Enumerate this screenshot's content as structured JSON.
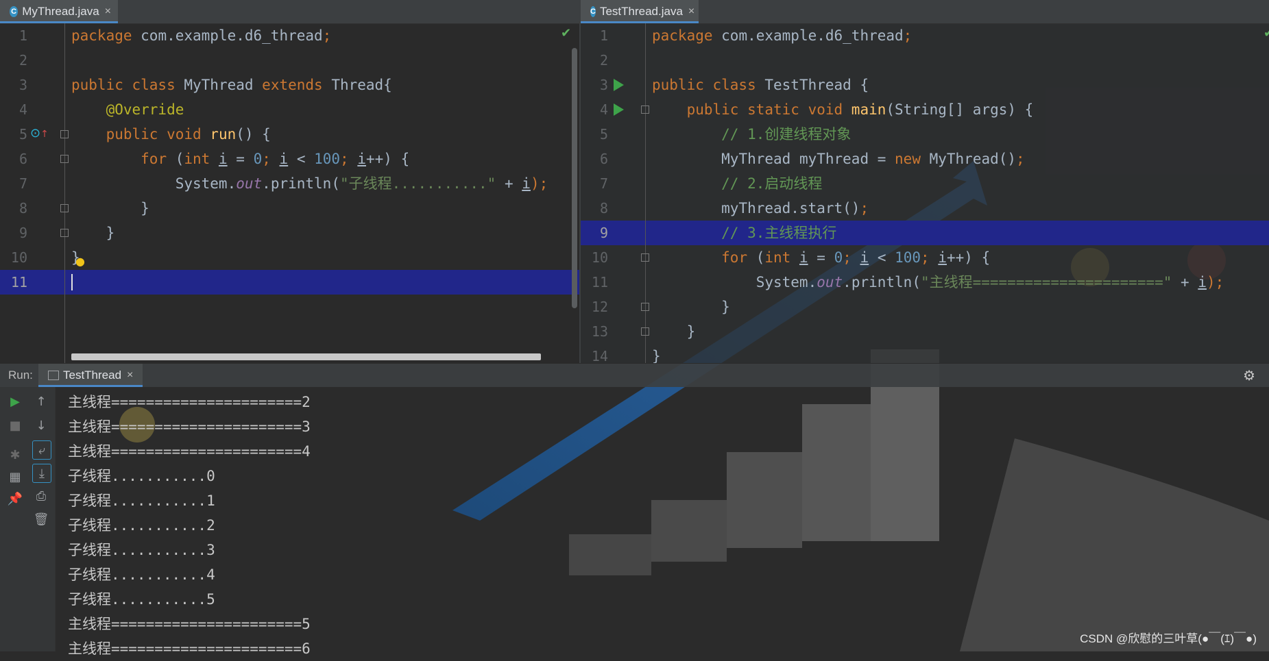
{
  "colors": {
    "accent": "#4a88c7",
    "current_line": "#21268a",
    "run_green": "#3ea34a"
  },
  "left_editor": {
    "tab_label": "MyThread.java",
    "file_icon": "C",
    "line_numbers": [
      "1",
      "2",
      "3",
      "4",
      "5",
      "6",
      "7",
      "8",
      "9",
      "10",
      "11"
    ],
    "lines": [
      {
        "parts": [
          {
            "t": "package ",
            "c": "kw"
          },
          {
            "t": "com.example.d6_thread",
            "c": "cls"
          },
          {
            "t": ";",
            "c": "semi"
          }
        ]
      },
      {
        "parts": []
      },
      {
        "parts": [
          {
            "t": "public class ",
            "c": "kw"
          },
          {
            "t": "MyThread ",
            "c": "cls"
          },
          {
            "t": "extends ",
            "c": "kw"
          },
          {
            "t": "Thread{",
            "c": "cls"
          }
        ]
      },
      {
        "parts": [
          {
            "t": "    "
          },
          {
            "t": "@Override",
            "c": "ann"
          }
        ]
      },
      {
        "parts": [
          {
            "t": "    "
          },
          {
            "t": "public void ",
            "c": "kw"
          },
          {
            "t": "run",
            "c": "fn"
          },
          {
            "t": "() {",
            "c": "cls"
          }
        ]
      },
      {
        "parts": [
          {
            "t": "        "
          },
          {
            "t": "for ",
            "c": "kw"
          },
          {
            "t": "(",
            "c": "cls"
          },
          {
            "t": "int ",
            "c": "kw"
          },
          {
            "t": "i",
            "c": "var"
          },
          {
            "t": " = ",
            "c": "cls"
          },
          {
            "t": "0",
            "c": "num"
          },
          {
            "t": "; ",
            "c": "semi"
          },
          {
            "t": "i",
            "c": "var"
          },
          {
            "t": " < ",
            "c": "cls"
          },
          {
            "t": "100",
            "c": "num"
          },
          {
            "t": "; ",
            "c": "semi"
          },
          {
            "t": "i",
            "c": "var"
          },
          {
            "t": "++) {",
            "c": "cls"
          }
        ]
      },
      {
        "parts": [
          {
            "t": "            "
          },
          {
            "t": "System.",
            "c": "cls"
          },
          {
            "t": "out",
            "c": "field"
          },
          {
            "t": ".println(",
            "c": "cls"
          },
          {
            "t": "\"子线程...........\"",
            "c": "str"
          },
          {
            "t": " + ",
            "c": "cls"
          },
          {
            "t": "i",
            "c": "var"
          },
          {
            "t": ");",
            "c": "semi"
          }
        ]
      },
      {
        "parts": [
          {
            "t": "        "
          },
          {
            "t": "}",
            "c": "cls"
          }
        ]
      },
      {
        "parts": [
          {
            "t": "    "
          },
          {
            "t": "}",
            "c": "cls"
          }
        ]
      },
      {
        "parts": [
          {
            "t": "}",
            "c": "cls"
          }
        ]
      },
      {
        "parts": []
      }
    ]
  },
  "right_editor": {
    "tab_label": "TestThread.java",
    "file_icon": "C",
    "line_numbers": [
      "1",
      "2",
      "3",
      "4",
      "5",
      "6",
      "7",
      "8",
      "9",
      "10",
      "11",
      "12",
      "13",
      "14"
    ],
    "lines": [
      {
        "parts": [
          {
            "t": "package ",
            "c": "kw"
          },
          {
            "t": "com.example.d6_thread",
            "c": "cls"
          },
          {
            "t": ";",
            "c": "semi"
          }
        ]
      },
      {
        "parts": []
      },
      {
        "parts": [
          {
            "t": "public class ",
            "c": "kw"
          },
          {
            "t": "TestThread {",
            "c": "cls"
          }
        ]
      },
      {
        "parts": [
          {
            "t": "    "
          },
          {
            "t": "public static void ",
            "c": "kw"
          },
          {
            "t": "main",
            "c": "fn"
          },
          {
            "t": "(String[] args) {",
            "c": "cls"
          }
        ]
      },
      {
        "parts": [
          {
            "t": "        "
          },
          {
            "t": "// 1.创建线程对象",
            "c": "cmt"
          }
        ]
      },
      {
        "parts": [
          {
            "t": "        "
          },
          {
            "t": "MyThread myThread = ",
            "c": "cls"
          },
          {
            "t": "new ",
            "c": "kw"
          },
          {
            "t": "MyThread()",
            "c": "cls"
          },
          {
            "t": ";",
            "c": "semi"
          }
        ]
      },
      {
        "parts": [
          {
            "t": "        "
          },
          {
            "t": "// 2.启动线程",
            "c": "cmt"
          }
        ]
      },
      {
        "parts": [
          {
            "t": "        "
          },
          {
            "t": "myThread.start()",
            "c": "cls"
          },
          {
            "t": ";",
            "c": "semi"
          }
        ]
      },
      {
        "parts": [
          {
            "t": "        "
          },
          {
            "t": "// 3.主线程执行",
            "c": "cmt"
          }
        ]
      },
      {
        "parts": [
          {
            "t": "        "
          },
          {
            "t": "for ",
            "c": "kw"
          },
          {
            "t": "(",
            "c": "cls"
          },
          {
            "t": "int ",
            "c": "kw"
          },
          {
            "t": "i",
            "c": "var"
          },
          {
            "t": " = ",
            "c": "cls"
          },
          {
            "t": "0",
            "c": "num"
          },
          {
            "t": "; ",
            "c": "semi"
          },
          {
            "t": "i",
            "c": "var"
          },
          {
            "t": " < ",
            "c": "cls"
          },
          {
            "t": "100",
            "c": "num"
          },
          {
            "t": "; ",
            "c": "semi"
          },
          {
            "t": "i",
            "c": "var"
          },
          {
            "t": "++) {",
            "c": "cls"
          }
        ]
      },
      {
        "parts": [
          {
            "t": "            "
          },
          {
            "t": "System.",
            "c": "cls"
          },
          {
            "t": "out",
            "c": "field"
          },
          {
            "t": ".println(",
            "c": "cls"
          },
          {
            "t": "\"主线程======================\"",
            "c": "str"
          },
          {
            "t": " + ",
            "c": "cls"
          },
          {
            "t": "i",
            "c": "var"
          },
          {
            "t": ");",
            "c": "semi"
          }
        ]
      },
      {
        "parts": [
          {
            "t": "        "
          },
          {
            "t": "}",
            "c": "cls"
          }
        ]
      },
      {
        "parts": [
          {
            "t": "    "
          },
          {
            "t": "}",
            "c": "cls"
          }
        ]
      },
      {
        "parts": [
          {
            "t": "}",
            "c": "cls"
          }
        ]
      }
    ]
  },
  "run_panel": {
    "label": "Run:",
    "tab_label": "TestThread",
    "toolbar_icons": [
      "run-icon",
      "up-arrow-icon",
      "stop-icon",
      "down-arrow-icon",
      "soft-wrap-icon",
      "debug-icon",
      "scroll-to-end-icon",
      "layout-icon",
      "print-icon",
      "pin-icon",
      "trash-icon"
    ],
    "output": [
      "主线程======================2",
      "主线程======================3",
      "主线程======================4",
      "子线程...........0",
      "子线程...........1",
      "子线程...........2",
      "子线程...........3",
      "子线程...........4",
      "子线程...........5",
      "主线程======================5",
      "主线程======================6"
    ]
  },
  "watermark": "CSDN @欣慰的三叶草(●￣(ｴ)￣●)"
}
